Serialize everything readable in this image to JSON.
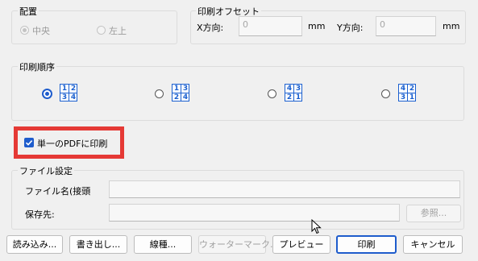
{
  "placement": {
    "title": "配置",
    "center_label": "中央",
    "top_left_label": "左上"
  },
  "print_offset": {
    "title": "印刷オフセット",
    "x_label": "X方向:",
    "x_value": "0",
    "x_unit": "mm",
    "y_label": "Y方向:",
    "y_value": "0",
    "y_unit": "mm"
  },
  "print_order": {
    "title": "印刷順序",
    "options": [
      {
        "grid": [
          "1",
          "2",
          "3",
          "4"
        ],
        "selected": true
      },
      {
        "grid": [
          "1",
          "3",
          "2",
          "4"
        ],
        "selected": false
      },
      {
        "grid": [
          "4",
          "3",
          "2",
          "1"
        ],
        "selected": false
      },
      {
        "grid": [
          "4",
          "2",
          "3",
          "1"
        ],
        "selected": false
      }
    ]
  },
  "single_pdf": {
    "label": "単一のPDFに印刷",
    "checked": true,
    "highlight_color": "#e53935"
  },
  "file_settings": {
    "title": "ファイル設定",
    "filename_label": "ファイル名(接頭",
    "filename_value": "",
    "save_to_label": "保存先:",
    "save_to_value": "",
    "browse_label": "参照..."
  },
  "buttons": {
    "load": "読み込み...",
    "export": "書き出し...",
    "line": "線種...",
    "watermark": "ウォーターマーク...",
    "preview": "プレビュー",
    "print": "印刷",
    "cancel": "キャンセル"
  },
  "colors": {
    "accent": "#1e5ccc",
    "window_bg": "#f0f0f0"
  }
}
